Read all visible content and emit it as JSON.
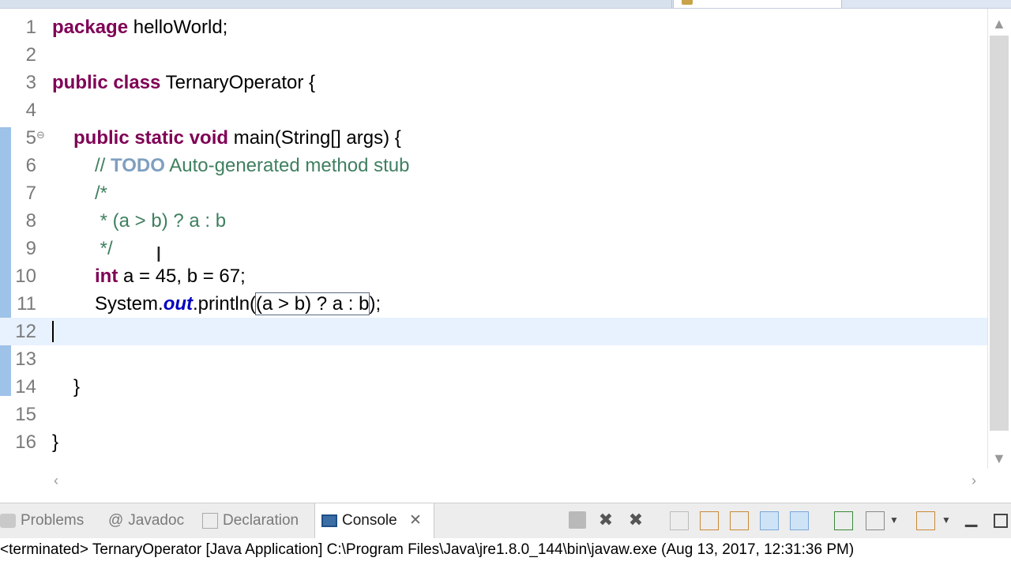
{
  "editor": {
    "line_numbers": [
      "1",
      "2",
      "3",
      "4",
      "5",
      "6",
      "7",
      "8",
      "9",
      "10",
      "11",
      "12",
      "13",
      "14",
      "15",
      "16"
    ],
    "lines": {
      "l1": {
        "kw": "package",
        "rest": " helloWorld;"
      },
      "l3": {
        "kw": "public class",
        "rest": " TernaryOperator {"
      },
      "l5": {
        "kw": "public static void",
        "rest": " main(String[] args) {"
      },
      "l6": {
        "prefix": "// ",
        "todo": "TODO",
        "rest": " Auto-generated method stub"
      },
      "l7": {
        "text": "/*"
      },
      "l8": {
        "text": " * (a > b) ? a : b"
      },
      "l9": {
        "text": " */"
      },
      "l10": {
        "kw": "int",
        "rest": " a = 45, b = 67;"
      },
      "l11": {
        "pre": "System.",
        "field": "out",
        "mid": ".println(",
        "sel": "(a > b) ? a : b",
        "post": ");"
      },
      "l14": {
        "text": "}"
      },
      "l16": {
        "text": "}"
      }
    }
  },
  "console_panel": {
    "tabs": {
      "problems": "Problems",
      "javadoc": "Javadoc",
      "declaration": "Declaration",
      "console": "Console"
    },
    "status_text": "<terminated> TernaryOperator [Java Application] C:\\Program Files\\Java\\jre1.8.0_144\\bin\\javaw.exe (Aug 13, 2017, 12:31:36 PM)"
  },
  "colors": {
    "keyword": "#7f0055",
    "comment": "#3f7f5f",
    "todo": "#7f9fbf",
    "field": "#0000c0",
    "current_line": "#e8f2fe"
  }
}
